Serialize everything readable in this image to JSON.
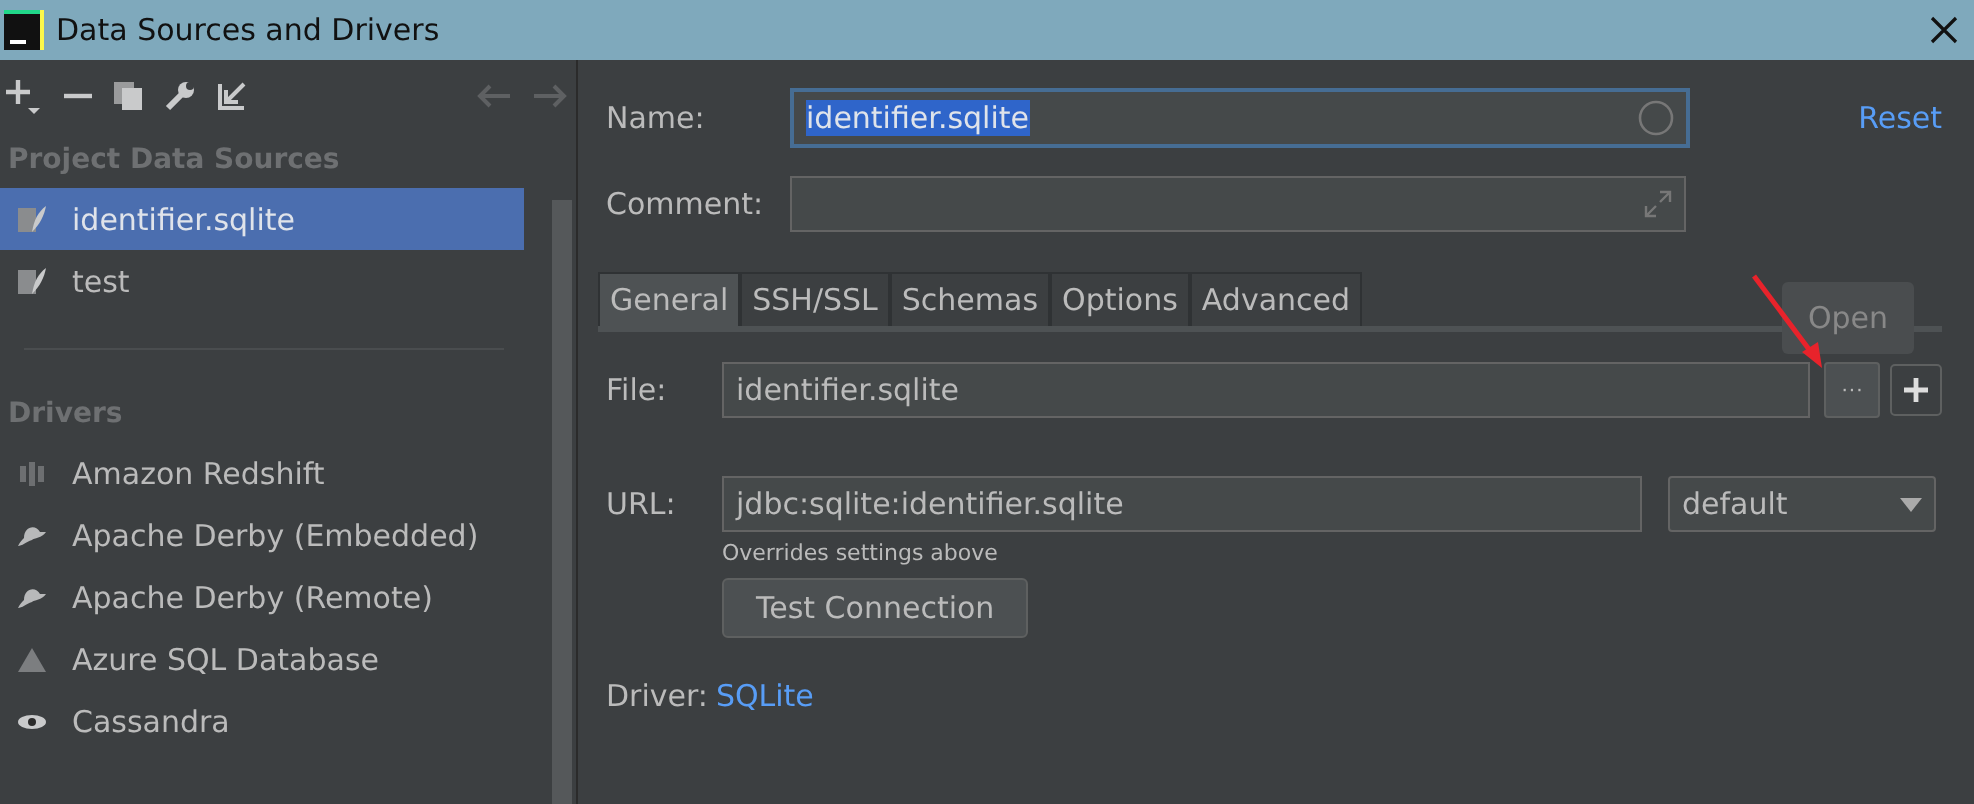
{
  "window": {
    "title": "Data Sources and Drivers"
  },
  "sidebar": {
    "sections": [
      {
        "heading": "Project Data Sources",
        "items": [
          {
            "label": "identifier.sqlite",
            "kind": "sqlite",
            "selected": true
          },
          {
            "label": "test",
            "kind": "sqlite",
            "selected": false
          }
        ]
      },
      {
        "heading": "Drivers",
        "items": [
          {
            "label": "Amazon Redshift",
            "kind": "bars",
            "selected": false
          },
          {
            "label": "Apache Derby (Embedded)",
            "kind": "hat",
            "selected": false
          },
          {
            "label": "Apache Derby (Remote)",
            "kind": "hat",
            "selected": false
          },
          {
            "label": "Azure SQL Database",
            "kind": "triangle",
            "selected": false
          },
          {
            "label": "Cassandra",
            "kind": "eye",
            "selected": false
          }
        ]
      }
    ]
  },
  "form": {
    "name_label": "Name:",
    "name_value": "identifier.sqlite",
    "comment_label": "Comment:",
    "reset": "Reset"
  },
  "tabs": [
    {
      "label": "General",
      "selected": true
    },
    {
      "label": "SSH/SSL",
      "selected": false
    },
    {
      "label": "Schemas",
      "selected": false
    },
    {
      "label": "Options",
      "selected": false
    },
    {
      "label": "Advanced",
      "selected": false
    }
  ],
  "general": {
    "file_label": "File:",
    "file_value": "identifier.sqlite",
    "browse_button": "···",
    "tooltip": "Open",
    "url_label": "URL:",
    "url_value": "jdbc:sqlite:identifier.sqlite",
    "url_mode": "default",
    "hint": "Overrides settings above",
    "test_button": "Test Connection",
    "driver_label": "Driver:",
    "driver_link": "SQLite"
  }
}
